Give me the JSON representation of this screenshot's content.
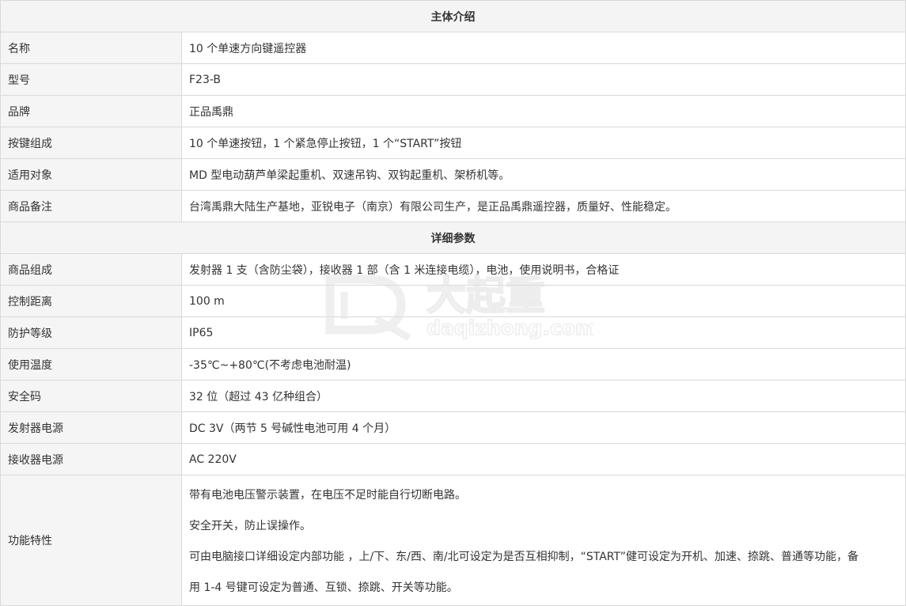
{
  "sections": [
    {
      "title": "主体介绍",
      "rows": [
        {
          "label": "名称",
          "value": "10 个单速方向键遥控器"
        },
        {
          "label": "型号",
          "value": "F23-B"
        },
        {
          "label": "品牌",
          "value": "正品禹鼎"
        },
        {
          "label": "按键组成",
          "value": "10 个单速按钮，1 个紧急停止按钮，1 个“START”按钮"
        },
        {
          "label": "适用对象",
          "value": "MD 型电动葫芦单梁起重机、双速吊钩、双钩起重机、架桥机等。"
        },
        {
          "label": "商品备注",
          "value": "台湾禹鼎大陆生产基地，亚锐电子（南京）有限公司生产，是正品禹鼎遥控器，质量好、性能稳定。"
        }
      ]
    },
    {
      "title": "详细参数",
      "rows": [
        {
          "label": "商品组成",
          "value": "发射器 1 支（含防尘袋），接收器 1 部（含 1 米连接电缆），电池，使用说明书，合格证"
        },
        {
          "label": "控制距离",
          "value": "100 m"
        },
        {
          "label": "防护等级",
          "value": "IP65"
        },
        {
          "label": "使用温度",
          "value": "-35℃~+80℃(不考虑电池耐温)"
        },
        {
          "label": "安全码",
          "value": "32 位（超过 43 亿种组合）"
        },
        {
          "label": "发射器电源",
          "value": "DC 3V（两节 5 号碱性电池可用 4 个月）"
        },
        {
          "label": "接收器电源",
          "value": "AC 220V"
        }
      ],
      "features": {
        "label": "功能特性",
        "lines": [
          "带有电池电压警示装置，在电压不足时能自行切断电路。",
          "安全开关，防止误操作。",
          "可由电脑接口详细设定内部功能 ，上/下、东/西、南/北可设定为是否互相抑制，“START”健可设定为开机、加速、捺跳、普通等功能，备",
          "用 1-4 号键可设定为普通、互锁、捺跳、开关等功能。"
        ]
      }
    }
  ],
  "watermark": {
    "brand": "大起重",
    "domain": "daqizhong.com",
    "logo_icon": "daqizhong-logo-icon"
  },
  "colors": {
    "border": "#d9d9d9",
    "header_bg": "#f4f4f4",
    "label_bg": "#f5f5f5",
    "text": "#333333",
    "watermark": "#e6e6e6"
  }
}
